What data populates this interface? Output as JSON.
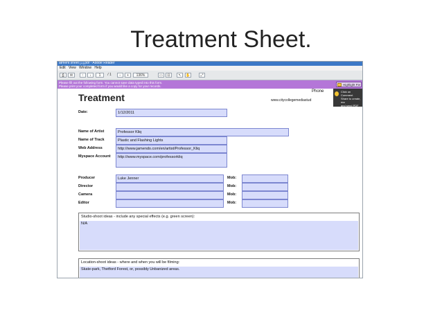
{
  "slide": {
    "title": "Treatment Sheet."
  },
  "window": {
    "title": "atment sheet [1].pdf - Adobe Reader"
  },
  "menu": [
    "Edit",
    "View",
    "Window",
    "Help"
  ],
  "toolbar": {
    "page_number": "1",
    "page_total": "/ 1",
    "zoom": "136%"
  },
  "infobar": {
    "line1": "Please fill out the following form. You cannot save data typed into this form.",
    "line2": "Please print your completed form if you would like a copy for your records.",
    "highlight_label": "Highlight Fie"
  },
  "tooltip": {
    "lines": [
      "Click on Comment",
      "Share to create, ma",
      "and send PDF files"
    ]
  },
  "document": {
    "title": "Treatment",
    "phone_label": "Phone",
    "website": "www.citycollegemediastud",
    "date": {
      "label": "Date:",
      "value": "1/12/2011"
    },
    "artist": {
      "label": "Name of Artist",
      "value": "Professor Kliq"
    },
    "track": {
      "label": "Name of Track",
      "value": "Plastic and Flashing Lights"
    },
    "web": {
      "label": "Web Address",
      "value": "http://www.jamendo.com/en/artist/Professor_Kliq"
    },
    "myspace": {
      "label": "Myspace Account",
      "value": "http://www.myspace.com/professorkliq"
    },
    "crew": [
      {
        "label": "Producer",
        "value": "Luke Jenner",
        "mob_label": "Mob:",
        "mob": ""
      },
      {
        "label": "Director",
        "value": "",
        "mob_label": "Mob:",
        "mob": ""
      },
      {
        "label": "Camera",
        "value": "",
        "mob_label": "Mob:",
        "mob": ""
      },
      {
        "label": "Editor",
        "value": "",
        "mob_label": "Mob:",
        "mob": ""
      }
    ],
    "studio": {
      "label": "Studio-shoot ideas - include any special effects (e.g. green screen):",
      "value": "N/A"
    },
    "location": {
      "label": "Location-shoot ideas - where and when you will be filming:",
      "value": "Skate-park, Thetford Forest, or, possibly Unbanized areas."
    }
  }
}
